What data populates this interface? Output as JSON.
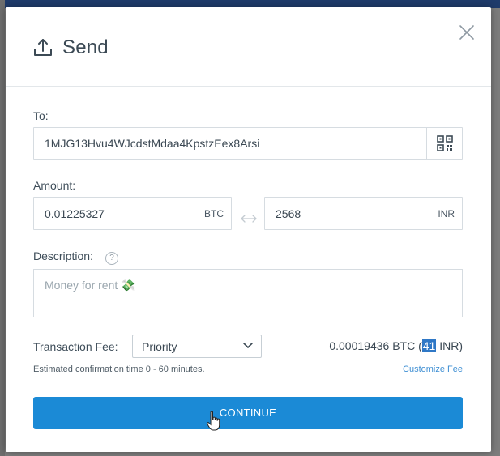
{
  "modal": {
    "title": "Send"
  },
  "to": {
    "label": "To:",
    "address": "1MJG13Hvu4WJcdstMdaa4KpstzEex8Arsi"
  },
  "amount": {
    "label": "Amount:",
    "btc_value": "0.01225327",
    "btc_unit": "BTC",
    "fiat_value": "2568",
    "fiat_unit": "INR"
  },
  "description": {
    "label": "Description:",
    "help": "?",
    "placeholder": "Money for rent 💸"
  },
  "fee": {
    "label": "Transaction Fee:",
    "selected": "Priority",
    "btc_amount": "0.00019436 BTC (",
    "fiat_highlight": "41",
    "fiat_suffix": " INR)",
    "estimate": "Estimated confirmation time 0 - 60 minutes.",
    "customize": "Customize Fee"
  },
  "actions": {
    "continue": "CONTINUE"
  },
  "colors": {
    "primary": "#1b8ad6",
    "link": "#3f8fd3",
    "highlight": "#2f78c6"
  }
}
